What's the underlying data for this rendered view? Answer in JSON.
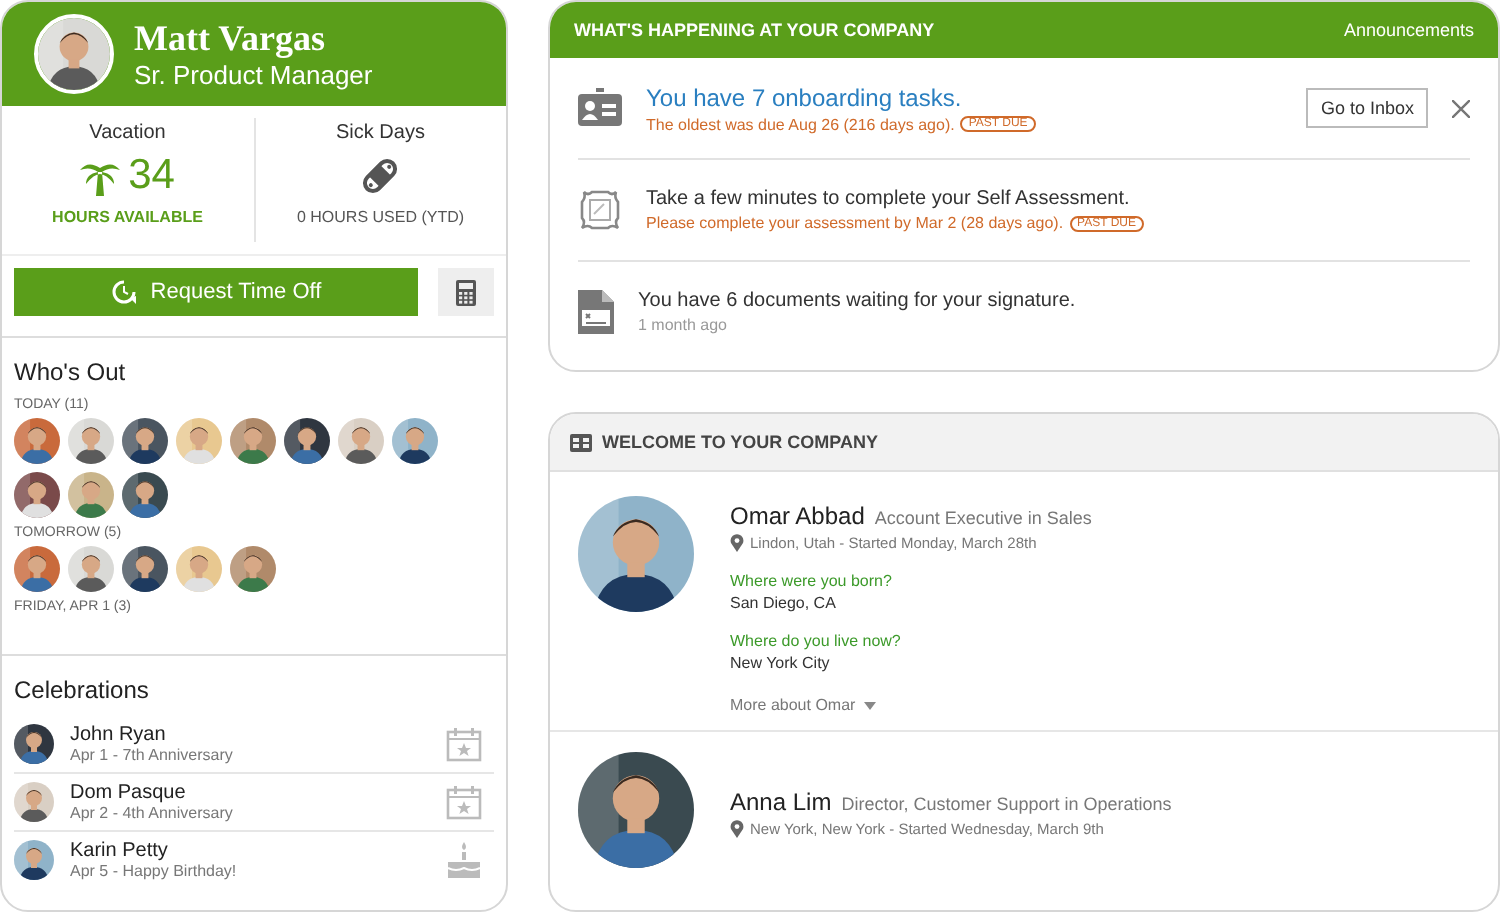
{
  "profile": {
    "name": "Matt Vargas",
    "title": "Sr. Product Manager",
    "avatar": {
      "kind": "picture"
    }
  },
  "balances": [
    {
      "kind": "vacation",
      "label": "Vacation",
      "value": "34",
      "caption": "HOURS AVAILABLE"
    },
    {
      "kind": "sick",
      "label": "Sick Days",
      "caption": "0 HOURS USED (YTD)"
    }
  ],
  "request_button": "Request Time Off",
  "whos_out": {
    "title": "Who's Out",
    "groups": [
      {
        "label": "TODAY (11)",
        "people": [
          {
            "kind": "picture"
          },
          {
            "kind": "picture"
          },
          {
            "kind": "picture"
          },
          {
            "kind": "picture"
          },
          {
            "kind": "picture"
          },
          {
            "kind": "picture"
          },
          {
            "kind": "picture"
          },
          {
            "kind": "picture"
          },
          {
            "kind": "picture"
          },
          {
            "kind": "picture"
          },
          {
            "kind": "picture"
          }
        ]
      },
      {
        "label": "TOMORROW (5)",
        "people": [
          {
            "kind": "picture"
          },
          {
            "kind": "picture"
          },
          {
            "kind": "picture"
          },
          {
            "kind": "picture"
          },
          {
            "kind": "picture"
          }
        ]
      },
      {
        "label": "FRIDAY, APR 1 (3)"
      }
    ]
  },
  "celebrations": {
    "title": "Celebrations",
    "items": [
      {
        "kind": "anniversary",
        "name": "John Ryan",
        "detail": "Apr 1 - 7th Anniversary"
      },
      {
        "kind": "anniversary",
        "name": "Dom Pasque",
        "detail": "Apr 2 - 4th Anniversary"
      },
      {
        "kind": "birthday",
        "name": "Karin Petty",
        "detail": "Apr 5 - Happy Birthday!"
      }
    ]
  },
  "happening": {
    "title": "WHAT'S HAPPENING AT YOUR COMPANY",
    "link": "Announcements",
    "items": [
      {
        "kind": "onboarding",
        "text": "You have 7 onboarding tasks.",
        "is_link": true,
        "note": "The oldest was due Aug 26 (216 days ago).",
        "overdue": true,
        "badge": "PAST DUE",
        "button": "Go to Inbox",
        "dismissible": true
      },
      {
        "kind": "assessment",
        "text": "Take a few minutes to complete your Self Assessment.",
        "is_link": false,
        "note": "Please complete your assessment by Mar 2 (28 days ago).",
        "overdue": true,
        "badge": "PAST DUE",
        "dismissible": false
      },
      {
        "kind": "document",
        "text": "You have 6 documents waiting for your signature.",
        "is_link": false,
        "note": "1 month ago",
        "overdue": false,
        "dismissible": false
      }
    ]
  },
  "welcome": {
    "title": "WELCOME TO YOUR COMPANY",
    "people": [
      {
        "name": "Omar Abbad",
        "role": "Account Executive in Sales",
        "location": "Lindon, Utah - Started Monday, March 28th",
        "avatar": {
          "kind": "picture"
        },
        "qa": [
          {
            "q": "Where were you born?",
            "a": "San Diego, CA"
          },
          {
            "q": "Where do you live now?",
            "a": "New York City"
          }
        ],
        "more": "More about Omar"
      },
      {
        "name": "Anna Lim",
        "role": "Director, Customer Support in Operations",
        "location": "New York, New York - Started Wednesday, March 9th",
        "avatar": {
          "kind": "picture"
        }
      }
    ]
  }
}
